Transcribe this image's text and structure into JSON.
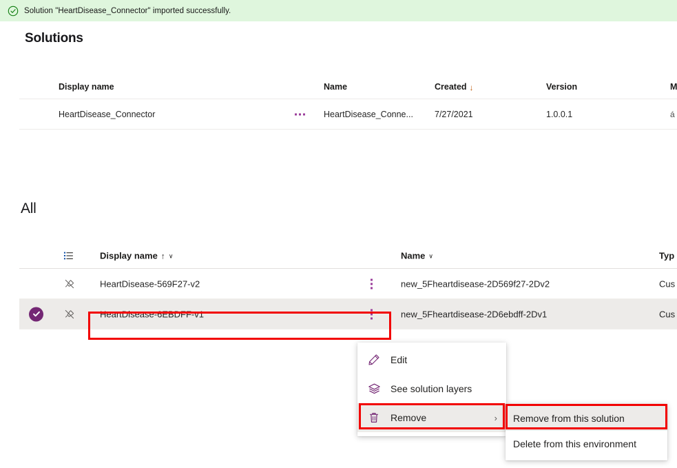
{
  "banner": {
    "icon": "check-circle-icon",
    "message": "Solution \"HeartDisease_Connector\" imported successfully.",
    "background": "#dff6dd",
    "icon_color": "#107c10"
  },
  "page": {
    "title": "Solutions"
  },
  "solutions_table": {
    "columns": [
      {
        "key": "display_name",
        "label": "Display name"
      },
      {
        "key": "name",
        "label": "Name"
      },
      {
        "key": "created",
        "label": "Created",
        "sort": "descending",
        "sort_glyph": "↓"
      },
      {
        "key": "version",
        "label": "Version"
      },
      {
        "key": "managed",
        "label": "M"
      }
    ],
    "rows": [
      {
        "display_name": "HeartDisease_Connector",
        "name": "HeartDisease_Conne...",
        "created": "7/27/2021",
        "version": "1.0.0.1",
        "managed": "á",
        "more_icon": "more-horizontal-icon"
      }
    ]
  },
  "all_section": {
    "title": "All",
    "columns": [
      {
        "key": "list",
        "label": "",
        "icon": "list-view-icon"
      },
      {
        "key": "display_name",
        "label": "Display name",
        "sort": "ascending",
        "sort_glyph": "↑",
        "chevron": "∨"
      },
      {
        "key": "name",
        "label": "Name",
        "chevron": "∨"
      },
      {
        "key": "type",
        "label": "Typ"
      }
    ],
    "rows": [
      {
        "selected": false,
        "pin_icon": "unpin-icon",
        "display_name": "HeartDisease-569F27-v2",
        "name": "new_5Fheartdisease-2D569f27-2Dv2",
        "type": "Cus",
        "more_icon": "more-vertical-icon"
      },
      {
        "selected": true,
        "select_icon": "check-circle-filled-icon",
        "pin_icon": "unpin-icon",
        "display_name": "HeartDisease-6EBDFF-v1",
        "name": "new_5Fheartdisease-2D6ebdff-2Dv1",
        "type": "Cus",
        "more_icon": "more-vertical-icon"
      }
    ]
  },
  "context_menu": {
    "items": [
      {
        "label": "Edit",
        "icon": "pencil-icon",
        "has_submenu": false,
        "hovered": false
      },
      {
        "label": "See solution layers",
        "icon": "layers-icon",
        "has_submenu": false,
        "hovered": false
      },
      {
        "label": "Remove",
        "icon": "trash-icon",
        "has_submenu": true,
        "submenu_glyph": "›",
        "hovered": true
      }
    ]
  },
  "submenu": {
    "items": [
      {
        "label": "Remove from this solution",
        "hovered": true
      },
      {
        "label": "Delete from this environment",
        "hovered": false
      }
    ]
  },
  "annotations": {
    "highlight_color": "#f20000",
    "boxes": [
      {
        "name": "selected-row-highlight",
        "target": "HeartDisease-6EBDFF-v1"
      },
      {
        "name": "remove-menu-item-highlight",
        "target": "Remove"
      },
      {
        "name": "remove-from-solution-highlight",
        "target": "Remove from this solution"
      }
    ]
  },
  "theme": {
    "accent": "#742774",
    "ellipsis": "#9b3d9b",
    "selected_row_bg": "#edebe9",
    "sort_desc_color": "#bd5a0a"
  }
}
